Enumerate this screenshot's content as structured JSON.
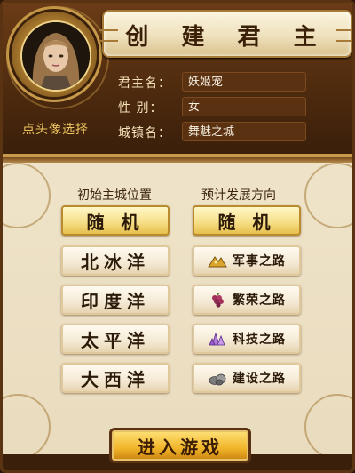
{
  "header": {
    "title": "创 建 君 主",
    "avatar_hint": "点头像选择"
  },
  "info": {
    "lord_name_label": "君主名：",
    "lord_name_value": "妖姬宠",
    "gender_label": "性  别：",
    "gender_value": "女",
    "city_name_label": "城镇名：",
    "city_name_value": "舞魅之城"
  },
  "left_column": {
    "heading": "初始主城位置",
    "options": [
      "随 机",
      "北冰洋",
      "印度洋",
      "太平洋",
      "大西洋"
    ]
  },
  "right_column": {
    "heading": "预计发展方向",
    "options": [
      "随 机",
      "军事之路",
      "繁荣之路",
      "科技之路",
      "建设之路"
    ]
  },
  "footer": {
    "enter_label": "进入游戏"
  },
  "colors": {
    "header_brown": "#4d2a0e",
    "parchment": "#efe3c8",
    "gold_accent": "#f0b429",
    "selected_button": "#f7e08a"
  },
  "icons": {
    "military": "gold-pile-icon",
    "prosperity": "grapes-icon",
    "technology": "crystal-icon",
    "construction": "stone-icon"
  }
}
